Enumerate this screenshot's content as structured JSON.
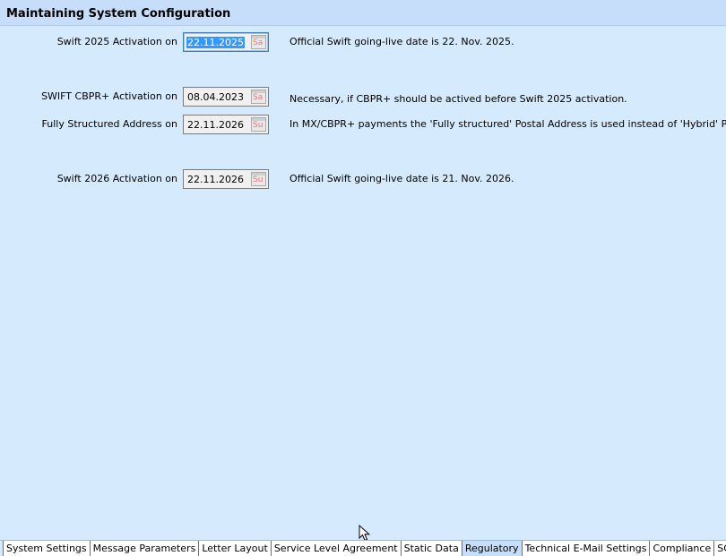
{
  "header": {
    "title": "Maintaining System Configuration"
  },
  "rows": [
    {
      "label": "Swift 2025 Activation on",
      "date": "22.11.2025",
      "weekday": "Sa",
      "description": "Official Swift going-live date is 22. Nov. 2025."
    },
    {
      "label": "SWIFT CBPR+ Activation on",
      "date": "08.04.2023",
      "weekday": "Sa",
      "description": "Necessary, if CBPR+ should be actived before Swift 2025 activation."
    },
    {
      "label": "Fully Structured Address on",
      "date": "22.11.2026",
      "weekday": "Su",
      "description": "In MX/CBPR+ payments the 'Fully structured' Postal Address is used instead of 'Hybrid' Postal Address"
    },
    {
      "label": "Swift 2026 Activation on",
      "date": "22.11.2026",
      "weekday": "Su",
      "description": "Official Swift going-live date is 21. Nov. 2026."
    }
  ],
  "tabs": [
    {
      "label": "System Settings"
    },
    {
      "label": "Message Parameters"
    },
    {
      "label": "Letter Layout"
    },
    {
      "label": "Service Level Agreement"
    },
    {
      "label": "Static Data"
    },
    {
      "label": "Regulatory",
      "active": true
    },
    {
      "label": "Technical E-Mail Settings"
    },
    {
      "label": "Compliance"
    },
    {
      "label": "SCF"
    }
  ],
  "icons": {
    "calendar": "calendar-icon",
    "cursor": "mouse-pointer-icon"
  },
  "colors": {
    "background": "#d5eafd",
    "header": "#c6defa",
    "selection": "#3399ff",
    "active_tab": "#c6defa"
  }
}
